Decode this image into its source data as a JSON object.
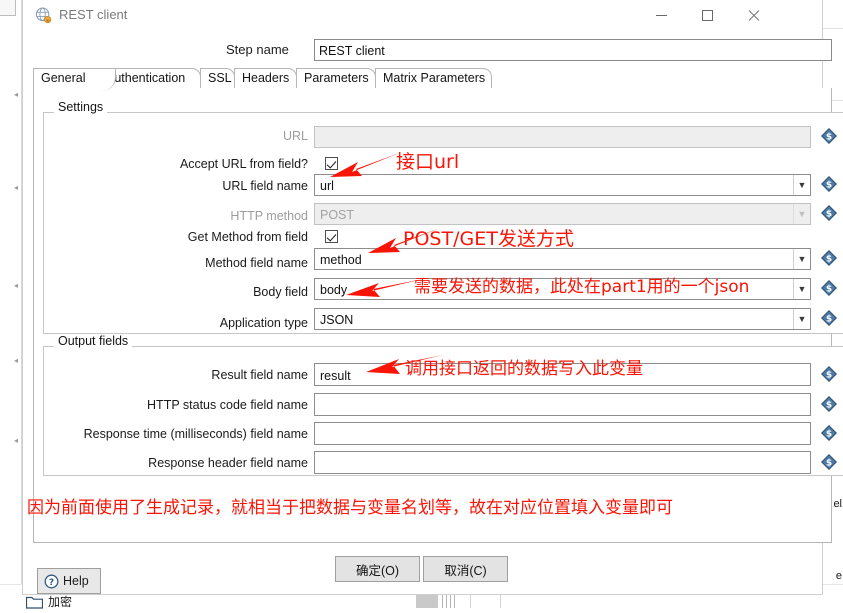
{
  "window": {
    "title": "REST client",
    "icon": "globe-icon",
    "minimize_label": "Minimize",
    "maximize_label": "Maximize",
    "close_label": "Close"
  },
  "step": {
    "label": "Step name",
    "value": "REST client"
  },
  "tabs": [
    {
      "label": "General",
      "active": true
    },
    {
      "label": "Authentication",
      "active": false
    },
    {
      "label": "SSL",
      "active": false
    },
    {
      "label": "Headers",
      "active": false
    },
    {
      "label": "Parameters",
      "active": false
    },
    {
      "label": "Matrix Parameters",
      "active": false
    }
  ],
  "settings": {
    "title": "Settings",
    "rows": {
      "url": {
        "label": "URL",
        "value": "",
        "disabled": true
      },
      "accept_url_from_field": {
        "label": "Accept URL from field?",
        "checked": true
      },
      "url_field_name": {
        "label": "URL field name",
        "value": "url"
      },
      "http_method": {
        "label": "HTTP method",
        "value": "POST",
        "disabled": true
      },
      "get_method_from_field": {
        "label": "Get Method from field",
        "checked": true
      },
      "method_field_name": {
        "label": "Method field name",
        "value": "method"
      },
      "body_field": {
        "label": "Body field",
        "value": "body"
      },
      "application_type": {
        "label": "Application type",
        "value": "JSON"
      }
    }
  },
  "output": {
    "title": "Output fields",
    "rows": {
      "result_field_name": {
        "label": "Result field name",
        "value": "result"
      },
      "http_status_code_field_name": {
        "label": "HTTP status code field name",
        "value": ""
      },
      "response_time_field_name": {
        "label": "Response time (milliseconds) field name",
        "value": ""
      },
      "response_header_field_name": {
        "label": "Response header field name",
        "value": ""
      }
    }
  },
  "annotations": {
    "color": "#fa1405",
    "url": "接口url",
    "method": "POST/GET发送方式",
    "body": "需要发送的数据，此处在part1用的一个json",
    "result": "调用接口返回的数据写入此变量",
    "bottom": "因为前面使用了生成记录，就相当于把数据与变量名划等，故在对应位置填入变量即可"
  },
  "buttons": {
    "help": "Help",
    "ok": "确定(O)",
    "ok_plain": "确定",
    "ok_mnemonic": "O",
    "cancel": "取消(C)",
    "cancel_plain": "取消",
    "cancel_mnemonic": "C"
  },
  "background": {
    "folder_label": "加密",
    "right_snippets": [
      "el",
      "e"
    ]
  },
  "icons": {
    "dollar_field": "dollar-diamond-icon",
    "combo_arrow": "chevron-down-icon",
    "help": "question-circle-icon",
    "folder": "folder-icon"
  }
}
